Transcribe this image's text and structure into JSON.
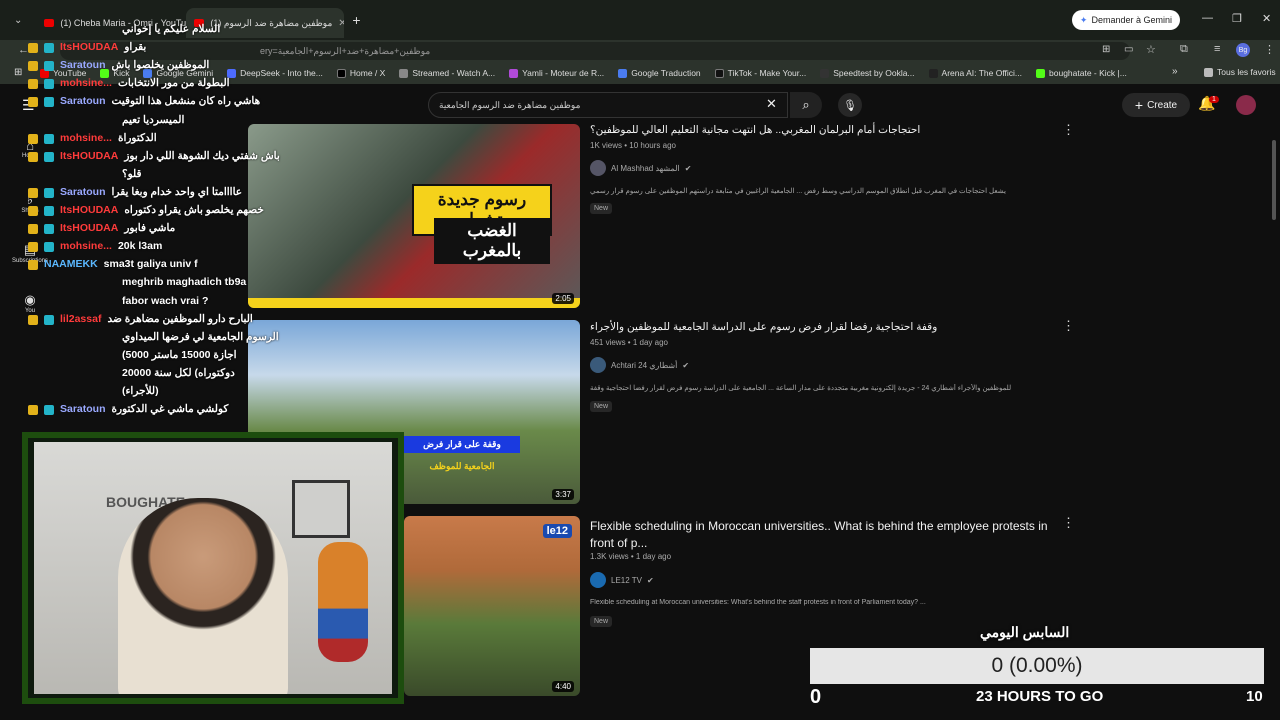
{
  "browser": {
    "tabs": [
      {
        "label": "(1) Cheba Maria - Omri - YouTu",
        "active": false
      },
      {
        "label": "(1) موظفين مضاهرة ضد الرسوم",
        "active": true
      }
    ],
    "new_tab": "+",
    "gemini_button": "Demander à Gemini",
    "url": "موظفين+مضاهرة+ضد+الرسوم+الجامعية",
    "url_prefix": "ery=",
    "bookmarks": [
      "YouTube",
      "Kick",
      "Google Gemini",
      "DeepSeek - Into the...",
      "Home / X",
      "Streamed - Watch A...",
      "Yamli - Moteur de R...",
      "Google Traduction",
      "TikTok - Make Your...",
      "Speedtest by Ookla...",
      "Arena AI: The Offici...",
      "boughatate - Kick |..."
    ],
    "all_bookmarks": "Tous les favoris",
    "more_bookmarks": "»"
  },
  "youtube": {
    "search_value": "موظفين مضاهرة ضد الرسوم الجامعية",
    "create_label": "Create",
    "notif_count": "1",
    "sidebar": [
      {
        "icon": "home-icon",
        "label": "Home"
      },
      {
        "icon": "shorts-icon",
        "label": "Shorts"
      },
      {
        "icon": "subscriptions-icon",
        "label": "Subscriptions"
      },
      {
        "icon": "you-icon",
        "label": "You"
      }
    ],
    "videos": [
      {
        "title": "احتجاجات أمام البرلمان المغربي.. هل انتهت مجانية التعليم العالي للموظفين؟",
        "meta": "1K views • 10 hours ago",
        "channel": "Al Mashhad المشهد",
        "desc": "يشعل احتجاجات في المغرب قبل انطلاق الموسم الدراسي وسط رفض ... الجامعية الراغبين في متابعة دراستهم الموظفين على رسوم قرار رسمي",
        "badge": "New",
        "duration": "2:05",
        "thumb_text_1": "رسوم جديدة تشعل",
        "thumb_text_2": "الغضب بالمغرب"
      },
      {
        "title": "وقفة احتجاجية رفضا لقرار فرض رسوم على الدراسة الجامعية للموظفين والأجراء",
        "meta": "451 views • 1 day ago",
        "channel": "Achtari 24 أشطاري",
        "desc": "للموظفين والأجراء أشطاري 24 - جريدة إلكترونية مغربية متجددة على مدار الساعة ... الجامعية على الدراسة رسوم فرض لقرار رفضا احتجاجية وقفة",
        "badge": "New",
        "duration": "3:37",
        "thumb_text_1": "وقفة على قرار فرض",
        "thumb_text_2": "الجامعية للموظف"
      },
      {
        "title": "Flexible scheduling in Moroccan universities.. What is behind the employee protests in front of p...",
        "meta": "1.3K views • 1 day ago",
        "channel": "LE12 TV",
        "desc": "Flexible scheduling at Moroccan universities: What's behind the staff protests in front of Parliament today? ...",
        "badge": "New",
        "duration": "4:40",
        "thumb_text_1": "le12",
        "thumb_text_2": ""
      }
    ]
  },
  "chat": [
    {
      "user": "",
      "msg": "السلام عليكم يا إخواني",
      "color": "#ffffff",
      "badge": "none"
    },
    {
      "user": "ItsHOUDAA",
      "msg": "بقراو",
      "color": "#ff3b3b",
      "badge": "crown"
    },
    {
      "user": "Saratoun",
      "msg": "الموظفين يخلصوا باش",
      "color": "#9aa9ff",
      "badge": "crown"
    },
    {
      "user": "mohsine...",
      "msg": "البطولة من مور الانتخابات",
      "color": "#ff3b3b",
      "badge": "crown"
    },
    {
      "user": "Saratoun",
      "msg": "هاشي راه كان منشعل هذا التوقيت",
      "color": "#9aa9ff",
      "badge": "crown"
    },
    {
      "user": "",
      "msg": "الميسرديا تعيم",
      "color": "#ffffff",
      "badge": "none"
    },
    {
      "user": "mohsine...",
      "msg": "الدكتوراة",
      "color": "#ff3b3b",
      "badge": "crown"
    },
    {
      "user": "ItsHOUDAA",
      "msg": "باش شفتي ديك الشوهة اللي دار بوز",
      "color": "#ff3b3b",
      "badge": "crown"
    },
    {
      "user": "",
      "msg": "قلو؟",
      "color": "#ffffff",
      "badge": "none"
    },
    {
      "user": "Saratoun",
      "msg": "عاااامتا اي واحد خدام وبغا يقرا",
      "color": "#9aa9ff",
      "badge": "crown"
    },
    {
      "user": "ItsHOUDAA",
      "msg": "خصهم يخلصو باش يقراو دكتوراه",
      "color": "#ff3b3b",
      "badge": "crown"
    },
    {
      "user": "ItsHOUDAA",
      "msg": "ماشي فابور",
      "color": "#ff3b3b",
      "badge": "crown"
    },
    {
      "user": "mohsine...",
      "msg": "20k l3am",
      "color": "#ff3b3b",
      "badge": "crown"
    },
    {
      "user": "NAAMEKK",
      "msg": "sma3t galiya univ f",
      "color": "#5bb8ff",
      "badge": "gold"
    },
    {
      "user": "",
      "msg": "meghrib maghadich tb9a",
      "color": "#ffffff",
      "badge": "none"
    },
    {
      "user": "",
      "msg": "fabor wach vrai ?",
      "color": "#ffffff",
      "badge": "none"
    },
    {
      "user": "lil2assaf",
      "msg": "البارح دارو الموظفين مضاهرة ضد",
      "color": "#ff3b3b",
      "badge": "crown"
    },
    {
      "user": "",
      "msg": "الرسوم الجامعية لي فرضها الميداوي",
      "color": "#ffffff",
      "badge": "none"
    },
    {
      "user": "",
      "msg": "(5000 اجازة 15000 ماستر",
      "color": "#ffffff",
      "badge": "none"
    },
    {
      "user": "",
      "msg": "20000 دوكتوراه) لكل سنة",
      "color": "#ffffff",
      "badge": "none"
    },
    {
      "user": "",
      "msg": "(للأجراء)",
      "color": "#ffffff",
      "badge": "none"
    },
    {
      "user": "Saratoun",
      "msg": "كولشي ماشي غي الدكتورة",
      "color": "#9aa9ff",
      "badge": "crown"
    }
  ],
  "webcam": {
    "wall_text": "BOUGHATE"
  },
  "goal": {
    "title": "السابس اليومي",
    "value_text": "0 (0.00%)",
    "progress": 0,
    "min": "0",
    "time_left": "23 HOURS TO GO",
    "max": "10",
    "fill_color": "#3cc24a"
  }
}
